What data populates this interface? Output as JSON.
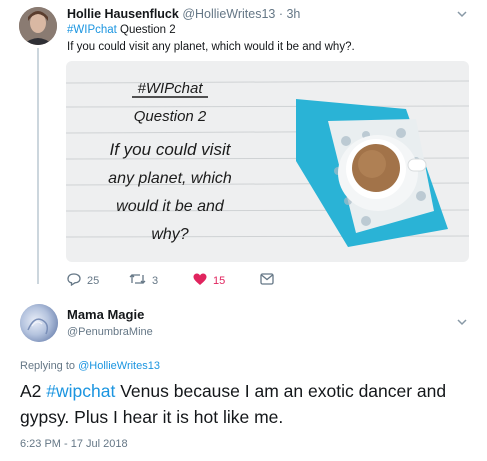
{
  "tweet1": {
    "author_name": "Hollie Hausenfluck",
    "author_meta": "@HollieWrites13 · 3h",
    "hashtag": "#WIPchat",
    "text_after_hashtag": " Question 2",
    "text_line2": "If you could visit any planet, which would it be and why?.",
    "image_text": {
      "line1": "#WIPchat",
      "line2": "Question 2",
      "line3": "If you could visit",
      "line4": "any planet, which",
      "line5": "would it be and",
      "line6": "why?"
    },
    "stats": {
      "replies": "25",
      "retweets": "3",
      "likes": "15"
    }
  },
  "tweet2": {
    "author_name": "Mama Magie",
    "author_handle": "@PenumbraMine",
    "replying_prefix": "Replying to ",
    "replying_handle": "@HollieWrites13",
    "body_prefix": "A2 ",
    "body_hashtag": "#wipchat",
    "body_rest": " Venus because I am an exotic dancer and gypsy. Plus I hear it is hot like me.",
    "timestamp": "6:23 PM - 17 Jul 2018"
  },
  "colors": {
    "link": "#1b95e0",
    "like": "#e0245e",
    "muted": "#657786",
    "thread": "#ccd6dd"
  },
  "icons": [
    "reply-icon",
    "retweet-icon",
    "heart-icon",
    "direct-message-icon",
    "chevron-down-icon"
  ]
}
